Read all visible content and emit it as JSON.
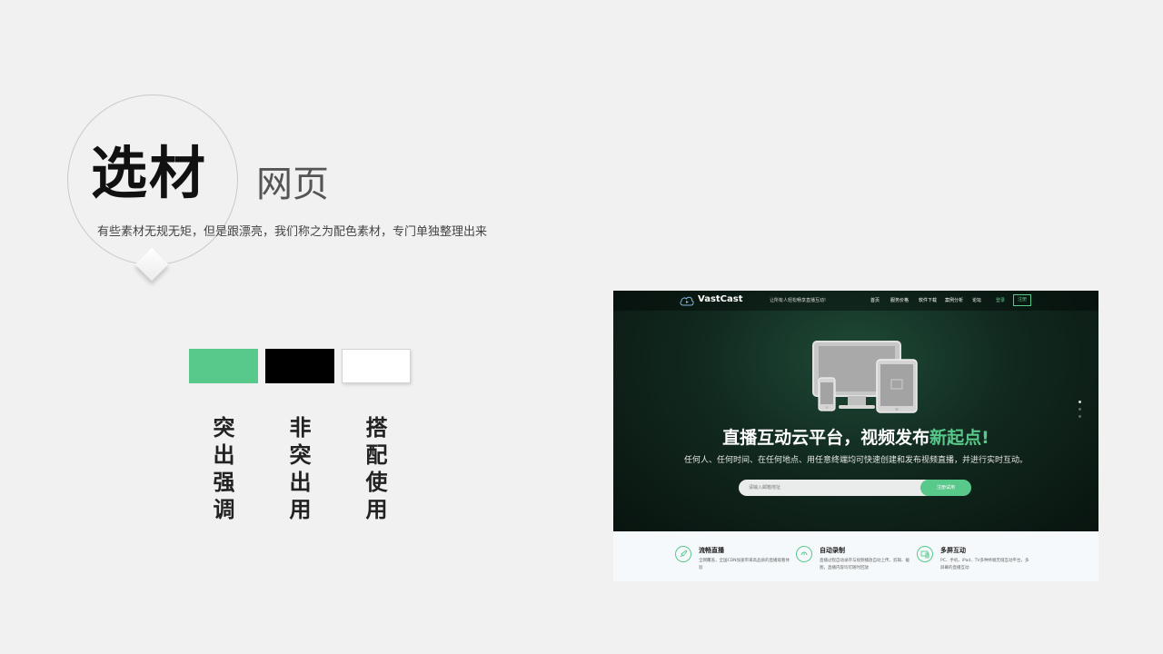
{
  "title": {
    "main": "选材",
    "sub": "网页",
    "subtitle": "有些素材无规无矩，但是跟漂亮，我们称之为配色素材，专门单独整理出来"
  },
  "swatches": [
    {
      "color": "#58c98a",
      "label": "突出强调"
    },
    {
      "color": "#000000",
      "label": "非突出用"
    },
    {
      "color": "#ffffff",
      "label": "搭配使用"
    }
  ],
  "webpage": {
    "logo": "VastCast",
    "logo_icon": "cloud-play-icon",
    "slogan": "让所有人轻松畅享直播互动!",
    "nav": [
      "首页",
      "服务价格",
      "软件下载",
      "案例分析",
      "论坛"
    ],
    "login": "登录",
    "register": "注册",
    "headline_main": "直播互动云平台，视频发布",
    "headline_accent": "新起点!",
    "tagline": "任何人、任何时间、在任何地点、用任意终端均可快速创建和发布视频直播，并进行实时互动。",
    "email_placeholder": "请输入邮箱地址",
    "try_button": "注册试用",
    "accent_color": "#58c98a",
    "features": [
      {
        "icon": "rocket-icon",
        "title": "流畅直播",
        "desc": "全网覆盖，全国CDN加速带来高品质的直播观看体验"
      },
      {
        "icon": "record-icon",
        "title": "自动录制",
        "desc": "直播过程自动录存与视频播放自动上传，剪辑、截图，直播内容均可随时回放"
      },
      {
        "icon": "screens-icon",
        "title": "多屏互动",
        "desc": "PC、手机、iPad、TV多种终端无缝互动平台，多屏幕的直播互动"
      }
    ]
  }
}
